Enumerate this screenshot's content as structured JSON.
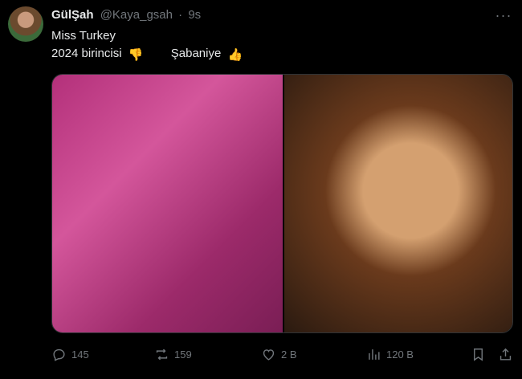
{
  "tweet": {
    "author_name": "GülŞah",
    "handle": "@Kaya_gsah",
    "separator": "·",
    "time": "9s",
    "more_label": "···",
    "lines": {
      "line1": "Miss Turkey",
      "line2_a": "2024 birincisi",
      "line2_b": "Şabaniye"
    },
    "emojis": {
      "thumbs_down": "👎",
      "thumbs_up": "👍"
    }
  },
  "actions": {
    "replies": "145",
    "reposts": "159",
    "likes": "2 B",
    "views": "120 B"
  },
  "colors": {
    "background": "#000000",
    "text": "#e7e9ea",
    "muted": "#71767b"
  }
}
